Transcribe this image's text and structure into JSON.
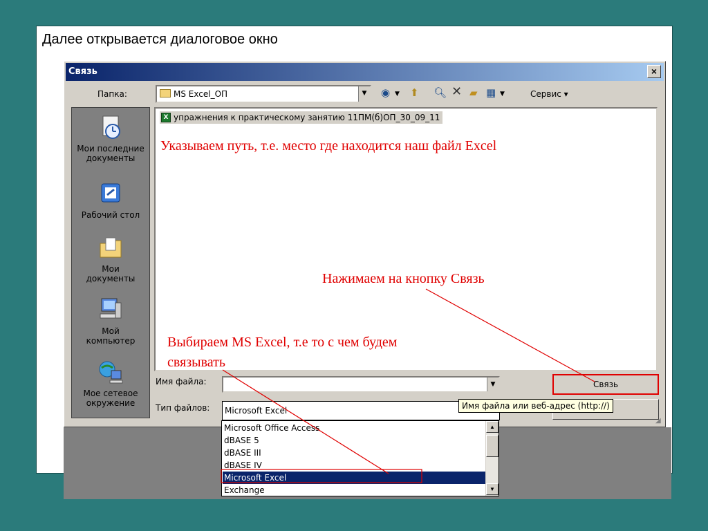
{
  "slide": {
    "title": "Далее открывается диалоговое окно"
  },
  "dialog": {
    "title": "Связь",
    "close_glyph": "×",
    "folder_label": "Папка:",
    "folder_value": "MS Excel_ОП",
    "toolbar": {
      "service_label": "Сервис ▾"
    },
    "places": [
      {
        "label_line1": "Мои последние",
        "label_line2": "документы",
        "icon": "recent-documents-icon"
      },
      {
        "label_line1": "Рабочий стол",
        "label_line2": "",
        "icon": "desktop-icon"
      },
      {
        "label_line1": "Мои",
        "label_line2": "документы",
        "icon": "my-documents-icon"
      },
      {
        "label_line1": "Мой",
        "label_line2": "компьютер",
        "icon": "my-computer-icon"
      },
      {
        "label_line1": "Мое сетевое",
        "label_line2": "окружение",
        "icon": "network-places-icon"
      }
    ],
    "file_item": "упражнения к практическому занятию 11ПМ(б)ОП_30_09_11",
    "filename_label": "Имя файла:",
    "filename_value": "",
    "filetype_label": "Тип файлов:",
    "filetype_value": "Microsoft Excel",
    "link_button": "Связь",
    "tooltip": "Имя файла или веб-адрес (http://)",
    "dropdown_options": [
      "Microsoft Office Access",
      "dBASE 5",
      "dBASE III",
      "dBASE IV",
      "Microsoft Excel",
      "Exchange"
    ],
    "dropdown_selected": "Microsoft Excel"
  },
  "annotations": {
    "path": "Указываем путь, т.е. место где находится наш файл Excel",
    "press": "Нажимаем на кнопку Связь",
    "choose_line1": "Выбираем MS Excel, т.е то с чем будем",
    "choose_line2": "связывать"
  },
  "colors": {
    "annotation": "#e00000",
    "background": "#2b7b7b",
    "titlebar": "#0a246a",
    "dialog_face": "#d4d0c8"
  }
}
